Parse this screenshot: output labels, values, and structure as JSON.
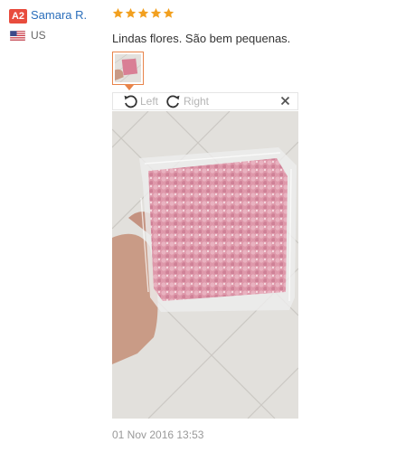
{
  "reviewer": {
    "level_badge": "A2",
    "name": "Samara R.",
    "country": "US",
    "flag_icon": "us-flag-icon"
  },
  "rating": {
    "stars": 5,
    "max": 5,
    "star_color": "#f2a01f"
  },
  "review": {
    "text": "Lindas flores. São bem pequenas.",
    "date": "01 Nov 2016 13:53"
  },
  "image_viewer": {
    "rotate_left_label": "Left",
    "rotate_right_label": "Right",
    "rotate_left_icon": "rotate-left-icon",
    "rotate_right_icon": "rotate-right-icon",
    "close_icon": "close-icon",
    "accent_color": "#e8844a"
  },
  "colors": {
    "name_link": "#2a6ebb",
    "badge": "#e84c3d",
    "flower_pink": "#d97f95"
  }
}
